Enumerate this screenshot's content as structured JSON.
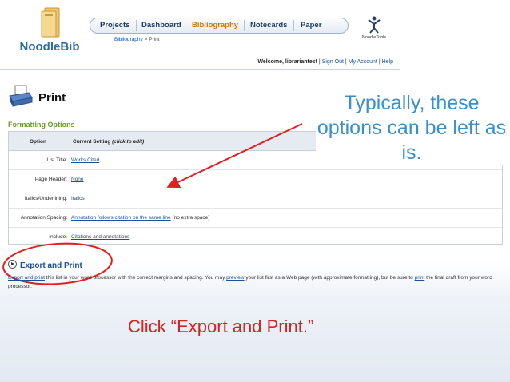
{
  "app": {
    "logo_text": "NoodleBib",
    "partner_logo_text": "NoodleTools"
  },
  "nav": {
    "tabs": [
      {
        "label": "Projects"
      },
      {
        "label": "Dashboard"
      },
      {
        "label": "Bibliography"
      },
      {
        "label": "Notecards"
      },
      {
        "label": "Paper"
      }
    ],
    "active_tab": "Bibliography"
  },
  "breadcrumb": {
    "link": "Bibliography",
    "separator": ">",
    "current": "Print"
  },
  "account": {
    "welcome": "Welcome, librariantest",
    "sign_out": "Sign Out",
    "my_account": "My Account",
    "help": "Help",
    "separator": "|"
  },
  "page": {
    "title": "Print",
    "section_title": "Formatting Options"
  },
  "table": {
    "col_option": "Option",
    "col_setting": "Current Setting",
    "col_setting_hint": "(click to edit)",
    "rows": [
      {
        "label": "List Title:",
        "value": "Works Cited",
        "extra": ""
      },
      {
        "label": "Page Header:",
        "value": "None",
        "extra": ""
      },
      {
        "label": "Italics/Underlining:",
        "value": "Italics",
        "extra": ""
      },
      {
        "label": "Annotation Spacing:",
        "value": "Annotation follows citation on the same line",
        "extra": "(no extra space)"
      },
      {
        "label": "Include:",
        "value": "Citations and annotations",
        "extra": ""
      }
    ]
  },
  "export": {
    "label": "Export and Print",
    "desc_link1": "Export and print",
    "desc_text1": "this list in your word processor with the correct margins and spacing. You may",
    "desc_link2": "preview",
    "desc_text2": "your list first as a Web page (with approximate formatting), but be sure to",
    "desc_link3": "print",
    "desc_text3": "the final draft from your word processor."
  },
  "annotations": {
    "callout": "Typically, these options can be left as is.",
    "bottom_note": "Click “Export and Print.”",
    "callout_color": "#3c8fc7",
    "highlight_color": "#e02020"
  }
}
